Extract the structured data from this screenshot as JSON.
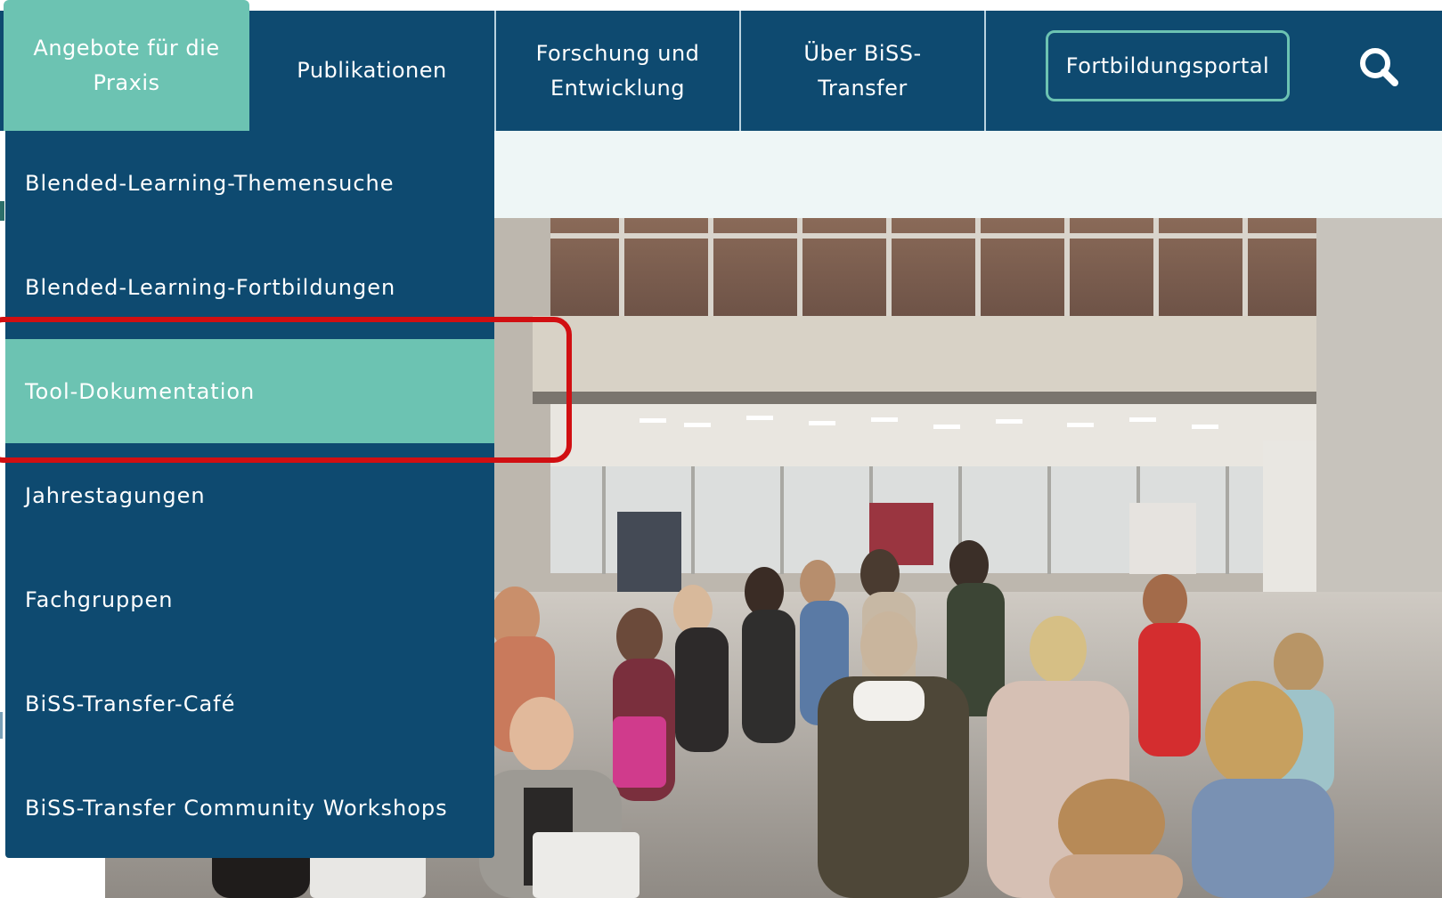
{
  "nav": {
    "items": [
      {
        "label_line1": "Angebote für die",
        "label_line2": "Praxis",
        "active": true
      },
      {
        "label_line1": "Publikationen",
        "label_line2": ""
      },
      {
        "label_line1": "Forschung und",
        "label_line2": "Entwicklung"
      },
      {
        "label_line1": "Über BiSS-",
        "label_line2": "Transfer"
      }
    ],
    "portal_label": "Fortbildungsportal",
    "search_icon": "search-icon"
  },
  "dropdown": {
    "items": [
      {
        "label": "Blended-Learning-Themensuche"
      },
      {
        "label": "Blended-Learning-Fortbildungen"
      },
      {
        "label": "Tool-Dokumentation",
        "selected": true
      },
      {
        "label": "Jahrestagungen"
      },
      {
        "label": "Fachgruppen"
      },
      {
        "label": "BiSS-Transfer-Café"
      },
      {
        "label": "BiSS-Transfer Community Workshops"
      }
    ]
  },
  "hero": {
    "image": "conference-crowd-photo"
  },
  "colors": {
    "nav_bg": "#0e4a70",
    "accent": "#6cc3b2",
    "highlight": "#d10f12"
  }
}
